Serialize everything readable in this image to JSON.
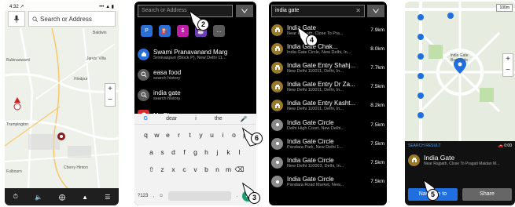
{
  "panel1": {
    "status_time": "4:32 ↗",
    "status_right": "••• ▲ ▮",
    "search_placeholder": "Search or Address",
    "map_labels": [
      "Baldwin",
      "Rubinaswami",
      "Jarvis' Villa",
      "Hindpur",
      "Trumpington",
      "Cherry Hinton",
      "Fulbourn"
    ],
    "zoom_in": "+",
    "zoom_out": "−",
    "bottom_icons": [
      "clock-icon",
      "volume-icon",
      "locate-icon",
      "route-icon",
      "menu-icon"
    ]
  },
  "panel2": {
    "search_placeholder": "Search or Address",
    "categories": [
      {
        "icon": "parking-icon",
        "color": "#2a6fd6",
        "glyph": "P"
      },
      {
        "icon": "fuel-icon",
        "color": "#2a6fd6",
        "glyph": "⛽"
      },
      {
        "icon": "atm-icon",
        "color": "#c01ea8",
        "glyph": "$"
      },
      {
        "icon": "food-icon",
        "color": "#6d3db7",
        "glyph": "☕"
      },
      {
        "icon": "more-icon",
        "color": "#5a5a5a",
        "glyph": "…"
      }
    ],
    "items": [
      {
        "title": "Swami Pranavanand Marg",
        "subtitle": "Srinivaspuri (Block P), New Delhi 11...",
        "icon": "home-icon",
        "color": "#2a6fd6"
      },
      {
        "title": "easa food",
        "subtitle": "search history",
        "icon": "search-icon",
        "color": "#5a5a5a"
      },
      {
        "title": "india gate",
        "subtitle": "search history",
        "icon": "search-icon",
        "color": "#5a5a5a"
      },
      {
        "title": "My Places",
        "subtitle": "",
        "icon": "places-icon",
        "color": "#d62a2a"
      }
    ],
    "suggestions": [
      "dear",
      "i",
      "the"
    ],
    "keyboard_rows": [
      [
        "q",
        "w",
        "e",
        "r",
        "t",
        "y",
        "u",
        "i",
        "o",
        "p"
      ],
      [
        "a",
        "s",
        "d",
        "f",
        "g",
        "h",
        "j",
        "k",
        "l"
      ],
      [
        "z",
        "x",
        "c",
        "v",
        "b",
        "n",
        "m"
      ]
    ],
    "bottom_left": "?123",
    "bottom_comma": ",",
    "bottom_period": "."
  },
  "panel3": {
    "query": "india gate",
    "results": [
      {
        "title": "India Gate",
        "subtitle": "Near Rajpath, Close To Pra...",
        "distance": "7.9km",
        "kind": "gate"
      },
      {
        "title": "India Gate Chak...",
        "subtitle": "India Gate Circle, New Delhi, In...",
        "distance": "8.0km",
        "kind": "gate"
      },
      {
        "title": "India Gate Entry Shahj...",
        "subtitle": "New Delhi 110011, Delhi, In...",
        "distance": "7.7km",
        "kind": "gate"
      },
      {
        "title": "India Gate Entry Dr Za...",
        "subtitle": "New Delhi 110011, Delhi, In...",
        "distance": "7.5km",
        "kind": "gate"
      },
      {
        "title": "India Gate Entry Kasht...",
        "subtitle": "New Delhi 110011, Delhi, In...",
        "distance": "8.2km",
        "kind": "gate"
      },
      {
        "title": "India Gate Circle",
        "subtitle": "Delhi High Court, New Delhi...",
        "distance": "7.5km",
        "kind": "circle"
      },
      {
        "title": "India Gate Circle",
        "subtitle": "Pandara Park, New Delhi 1...",
        "distance": "7.5km",
        "kind": "circle"
      },
      {
        "title": "India Gate Circle",
        "subtitle": "New Delhi 110003, Delhi, In...",
        "distance": "7.5km",
        "kind": "circle"
      },
      {
        "title": "India Gate Circle",
        "subtitle": "Pandara Road Market, New...",
        "distance": "7.5km",
        "kind": "circle"
      }
    ]
  },
  "panel4": {
    "scale": "100m",
    "map_label": "India Gate Boat Ride",
    "zoom_in": "+",
    "zoom_out": "−",
    "sheet_title": "SEARCH RESULT",
    "sheet_time": "0:00",
    "place_name": "India Gate",
    "place_address": "Near Rajpath, Close To Pragati Maidan M...",
    "navigate_label": "Navigate to",
    "share_label": "Share"
  },
  "steps": [
    "2",
    "4",
    "6",
    "3",
    "5"
  ]
}
